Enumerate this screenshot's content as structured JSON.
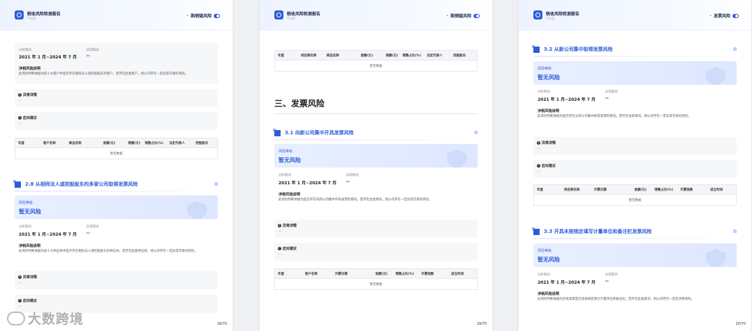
{
  "header": {
    "title": "税收风险检测报告",
    "subtitle": "**公司"
  },
  "pages": [
    {
      "header_section": "购销链风险",
      "page_number": "18/70",
      "top_card": {
        "analysis_label": "分析期间",
        "analysis_value": "2021 年 1 月~2024 年 7 月",
        "abnormal_label": "异常期间",
        "abnormal_value": "--",
        "desc_title": "涉税风险说明",
        "desc_text": "此风险判断依据为前十大客户中是否存在相同法人或控股股东的客户。若存在此类客户，则公司存在一定异常交易的风险。"
      },
      "box_detail": {
        "title": "异常详情",
        "body": "---"
      },
      "box_advice": {
        "title": "应对建议",
        "body": "---"
      },
      "table": {
        "headers": [
          "年度",
          "客户名称",
          "商品名称",
          "金额(元)",
          "税额(元)",
          "销售占比(%)",
          "法定代表人",
          "控股股东"
        ],
        "empty": "暂无数据"
      },
      "section": {
        "title": "2.8 从相同法人或控股股东的多家公司取得发票风险",
        "risk_label": "风险等级",
        "risk_value": "暂无风险",
        "analysis_label": "分析期间",
        "analysis_value": "2021 年 1 月~2024 年 7 月",
        "abnormal_label": "异常期间",
        "abnormal_value": "--",
        "desc_title": "涉税风险说明",
        "desc_text": "此风险判断依据为前十大供应商中是否存在相同法人或控股股东的供应商。若存在此类供应商，则公司存在一定异常交易的风险。"
      },
      "box_detail2": {
        "title": "异常详情",
        "body": "---"
      },
      "box_advice2": {
        "title": "应对建议",
        "body": "---"
      },
      "watermark": "大数跨境"
    },
    {
      "header_section": "购销链风险",
      "page_number": "19/70",
      "table_top": {
        "headers": [
          "年度",
          "供应商名称",
          "商品名称",
          "金额(元)",
          "税额(元)",
          "销售占比(%)",
          "法定代表人",
          "控股股东"
        ],
        "empty": "暂无数据"
      },
      "chapter": "三、发票风险",
      "section": {
        "title": "3.1 向新公司集中开具发票风险",
        "risk_label": "风险等级",
        "risk_value": "暂无风险",
        "analysis_label": "分析期间",
        "analysis_value": "2021 年 1 月~2024 年 7 月",
        "abnormal_label": "异常期间",
        "abnormal_value": "--",
        "desc_title": "涉税风险说明",
        "desc_text": "此风险判断依据为是否存在向新公司集中开具发票的情况。若存在此类情况，则公司存在一定异常交易的风险。"
      },
      "box_detail": {
        "title": "异常详情",
        "body": "---"
      },
      "box_advice": {
        "title": "应对建议",
        "body": "---"
      },
      "table": {
        "headers": [
          "年度",
          "客户名称",
          "开票日期",
          "金额(元)",
          "销售占比(%)",
          "开票张数",
          "成立时间"
        ],
        "empty": "暂无数据"
      }
    },
    {
      "header_section": "发票风险",
      "page_number": "20/70",
      "section": {
        "title": "3.2 从新公司集中取得发票风险",
        "risk_label": "风险等级",
        "risk_value": "暂无风险",
        "analysis_label": "分析期间",
        "analysis_value": "2021 年 1 月~2024 年 7 月",
        "abnormal_label": "异常期间",
        "abnormal_value": "--",
        "desc_title": "涉税风险说明",
        "desc_text": "此风险判断依据为是否存在从新公司集中取得发票的情况。若存在此类情况，则公司存在一定异常交易的风险。"
      },
      "box_detail": {
        "title": "异常详情",
        "body": "---"
      },
      "box_advice": {
        "title": "应对建议",
        "body": "---"
      },
      "table": {
        "headers": [
          "年度",
          "供应商名称",
          "开票日期",
          "金额(元)",
          "销售占比(%)",
          "开票张数",
          "成立时间"
        ],
        "empty": "暂无数据"
      },
      "section2": {
        "title": "3.3 开具未按规定填写计量单位和备注栏发票风险",
        "risk_label": "风险等级",
        "risk_value": "暂无风险",
        "analysis_label": "分析期间",
        "analysis_value": "2021 年 1 月~2024 年 7 月",
        "abnormal_label": "异常期间",
        "abnormal_value": "--",
        "desc_title": "涉税风险说明",
        "desc_text": "此风险判断依据为开具发票是否未按规定填写计量单位和备注栏。若存在此类情况，则公司存在一定的涉税风险。"
      }
    }
  ]
}
